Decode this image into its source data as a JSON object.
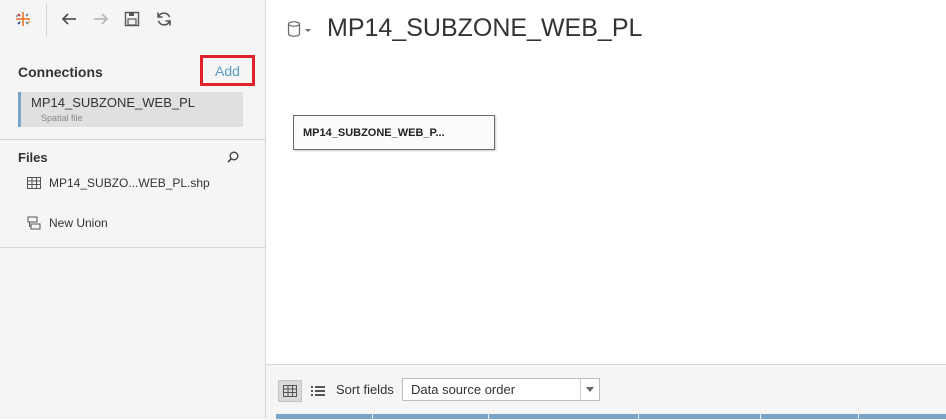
{
  "connections": {
    "header": "Connections",
    "add_label": "Add",
    "items": [
      {
        "name": "MP14_SUBZONE_WEB_PL",
        "type": "Spatial file"
      }
    ]
  },
  "files": {
    "header": "Files",
    "items": [
      {
        "label": "MP14_SUBZO...WEB_PL.shp",
        "icon": "table-grid-icon"
      },
      {
        "label": "New Union",
        "icon": "union-icon"
      }
    ]
  },
  "main": {
    "title": "MP14_SUBZONE_WEB_PL",
    "table_label": "MP14_SUBZONE_WEB_P..."
  },
  "bottom": {
    "sort_label": "Sort fields",
    "sort_value": "Data source order"
  },
  "colors": {
    "accent": "#5a9bc6",
    "highlight_border": "#e2202c",
    "selection_bar": "#7aa5c7"
  }
}
